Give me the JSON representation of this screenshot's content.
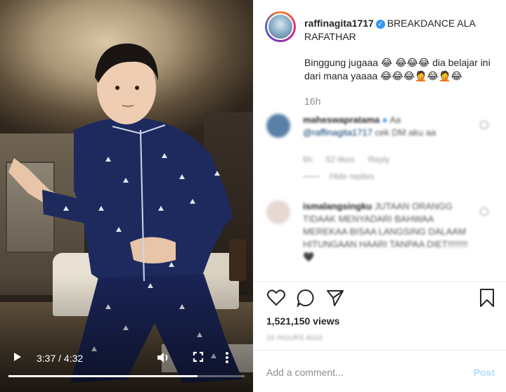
{
  "video": {
    "current_time": "3:37",
    "time_separator": "/",
    "duration": "4:32",
    "progress_fraction": 0.8,
    "icons": {
      "play": "play-icon",
      "volume": "volume-icon",
      "fullscreen": "fullscreen-icon",
      "more": "more-vertical-icon"
    }
  },
  "post": {
    "username": "raffinagita1717",
    "caption_title": "BREAKDANCE ALA RAFATHAR",
    "caption_body": "Binggung jugaaa 😂 😂😂😂 dia belajar ini dari mana yaaaa 😂😂😂🤦😂🤦😂",
    "time": "16h"
  },
  "comments": [
    {
      "username": "maheswapratama",
      "text_prefix": "Aa",
      "mention": "@raffinagita1717",
      "text_suffix": "cek DM aku aa",
      "meta": [
        "6h",
        "52 likes",
        "Reply"
      ],
      "replies": "Hide replies",
      "avatar_color": "#5a7fa8"
    },
    {
      "username": "ismalangsingku",
      "text": "JUTAAN ORANGG TIDAAK MENYADARI BAHWAA MEREKAA BISAA LANGSING DALAAM HITUNGAAN HAARI TANPAA DIET!!!!!!!!🖤",
      "avatar_color": "#e7d8d2"
    }
  ],
  "actions": {
    "like": "heart-icon",
    "comment": "comment-icon",
    "share": "share-icon",
    "save": "bookmark-icon"
  },
  "stats": {
    "views": "1,521,150 views",
    "ago": "16 HOURS AGO"
  },
  "comment_box": {
    "placeholder": "Add a comment...",
    "post_label": "Post"
  }
}
